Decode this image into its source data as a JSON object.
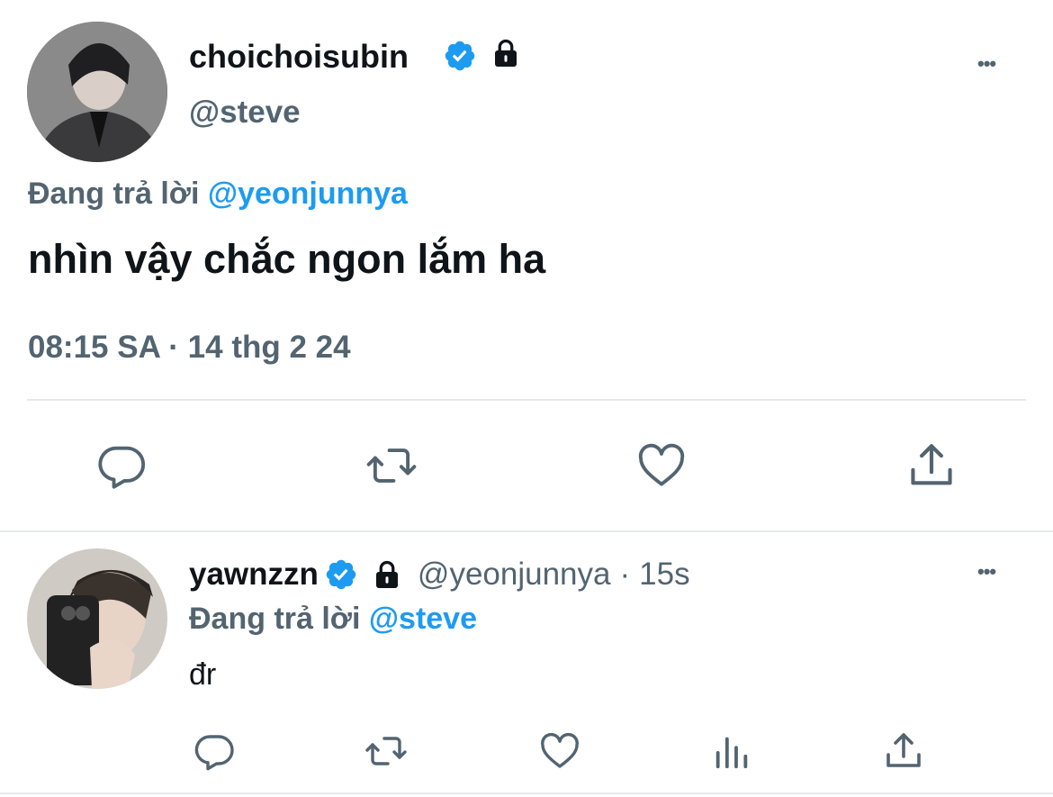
{
  "main_tweet": {
    "display_name": "choichoisubin",
    "handle": "@steve",
    "reply_prefix": "Đang trả lời",
    "reply_to": "@yeonjunnya",
    "text": "nhìn vậy chắc ngon lắm ha",
    "timestamp": "08:15 SA · 14 thg 2 24",
    "more_label": "•••"
  },
  "reply_tweet": {
    "display_name": "yawnzzn",
    "handle": "@yeonjunnya",
    "separator": "·",
    "time_ago": "15s",
    "reply_prefix": "Đang trả lời",
    "reply_to": "@steve",
    "text": "đr",
    "more_label": "•••"
  },
  "colors": {
    "verified": "#1d9bf0",
    "mention": "#1d9bf0",
    "secondary_text": "#536471",
    "divider": "#e6e9eb"
  },
  "icons": {
    "verified": "verified-badge-icon",
    "protected": "lock-icon",
    "more": "more-icon",
    "reply": "reply-icon",
    "retweet": "retweet-icon",
    "like": "like-icon",
    "views": "views-icon",
    "share": "share-icon"
  }
}
